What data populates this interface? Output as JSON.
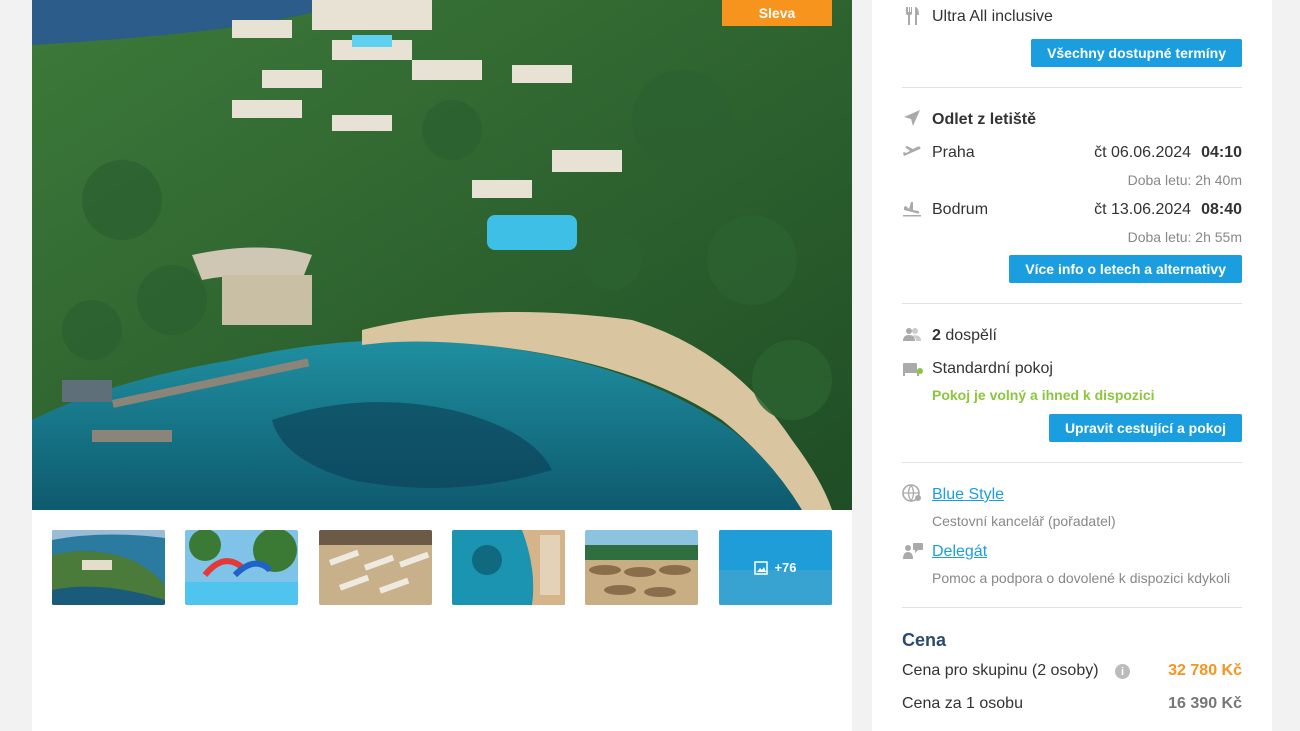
{
  "gallery": {
    "badge": "Sleva",
    "more_count": "+76"
  },
  "sidebar": {
    "board": "Ultra All inclusive",
    "all_dates_button": "Všechny dostupné termíny",
    "departure_title": "Odlet z letiště",
    "flights": [
      {
        "city": "Praha",
        "date": "čt 06.06.2024",
        "time": "04:10",
        "duration": "Doba letu: 2h 40m"
      },
      {
        "city": "Bodrum",
        "date": "čt 13.06.2024",
        "time": "08:40",
        "duration": "Doba letu: 2h 55m"
      }
    ],
    "flights_button": "Více info o letech a alternativy",
    "travelers_count": "2",
    "travelers_label": "dospělí",
    "room": "Standardní pokoj",
    "room_status": "Pokoj je volný a ihned k dispozici",
    "edit_button": "Upravit cestující a pokoj",
    "agency_name": "Blue Style",
    "agency_desc": "Cestovní kancelář (pořadatel)",
    "delegate_name": "Delegát",
    "delegate_desc": "Pomoc a podpora o dovolené k dispozici kdykoli"
  },
  "price": {
    "title": "Cena",
    "group_label": "Cena pro skupinu (2 osoby)",
    "group_value": "32 780 Kč",
    "person_label": "Cena za 1 osobu",
    "person_value": "16 390 Kč"
  },
  "colors": {
    "accent_blue": "#1a9ee0",
    "badge_orange": "#f7941d",
    "price_orange": "#f7941d",
    "status_green": "#8cc63f"
  }
}
